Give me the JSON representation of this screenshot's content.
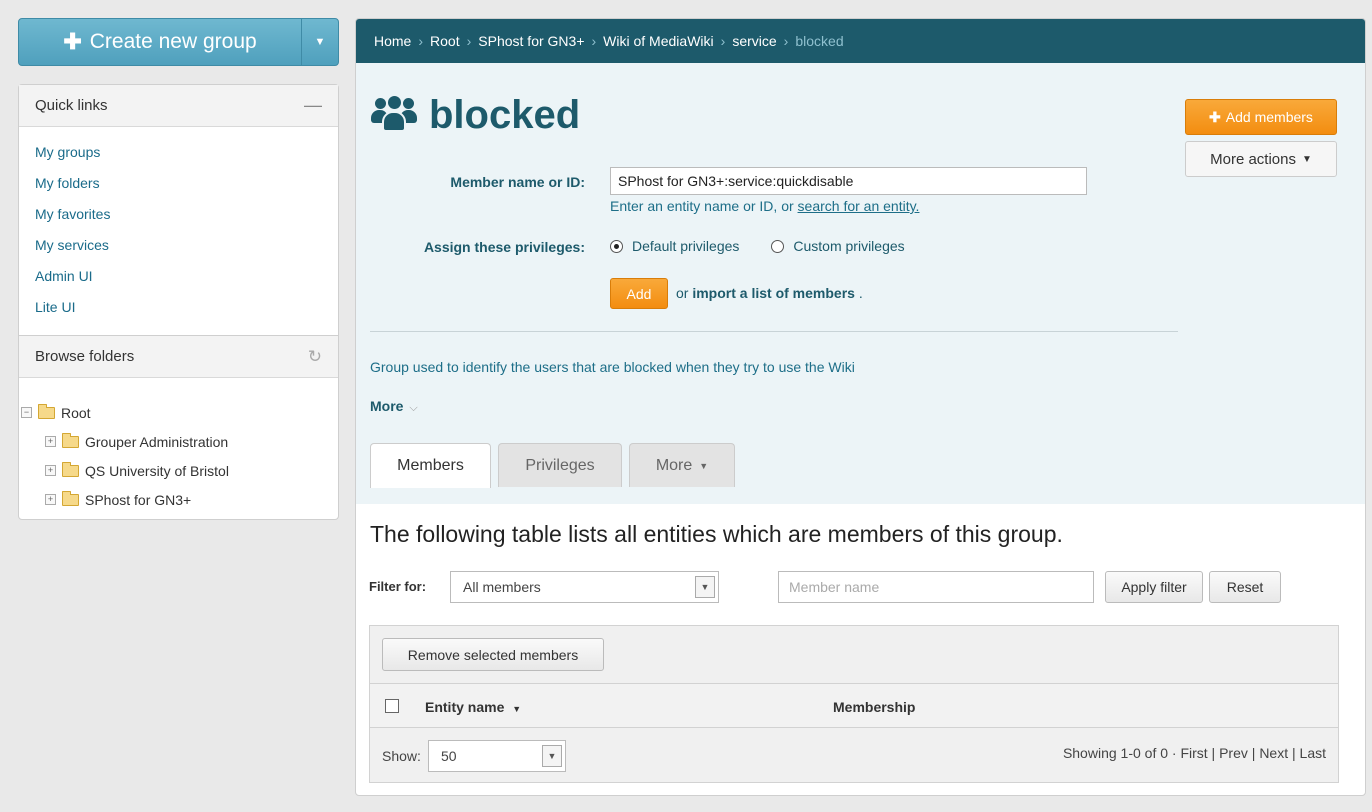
{
  "sidebar": {
    "create_label": "Create new group",
    "quick_links_title": "Quick links",
    "quick_links": [
      "My groups",
      "My folders",
      "My favorites",
      "My services",
      "Admin UI",
      "Lite UI"
    ],
    "browse_title": "Browse folders",
    "tree_root": "Root",
    "tree_children": [
      "Grouper Administration",
      "QS University of Bristol",
      "SPhost for GN3+"
    ]
  },
  "breadcrumb": [
    "Home",
    "Root",
    "SPhost for GN3+",
    "Wiki of MediaWiki",
    "service"
  ],
  "breadcrumb_current": "blocked",
  "group": {
    "title": "blocked",
    "add_members_label": "Add members",
    "more_actions_label": "More actions",
    "member_label": "Member name or ID:",
    "member_value": "SPhost for GN3+:service:quickdisable",
    "hint_text": "Enter an entity name or ID, or",
    "hint_link": "search for an entity.",
    "privileges_label": "Assign these privileges:",
    "default_privileges": "Default privileges",
    "custom_privileges": "Custom privileges",
    "add_label": "Add",
    "import_prefix": "or",
    "import_link": "import a list of members",
    "import_suffix": ".",
    "description": "Group used to identify the users that are blocked when they try to use the Wiki",
    "more_label": "More"
  },
  "tabs": [
    "Members",
    "Privileges",
    "More"
  ],
  "members": {
    "caption": "The following table lists all entities which are members of this group.",
    "filter_label": "Filter for:",
    "filter_value": "All members",
    "member_placeholder": "Member name",
    "apply_label": "Apply filter",
    "reset_label": "Reset",
    "remove_label": "Remove selected members",
    "col_entity": "Entity name",
    "col_membership": "Membership",
    "show_label": "Show:",
    "show_value": "50",
    "showing": "Showing 1-0 of 0 ·",
    "first": "First",
    "prev": "Prev",
    "next": "Next",
    "last": "Last"
  }
}
